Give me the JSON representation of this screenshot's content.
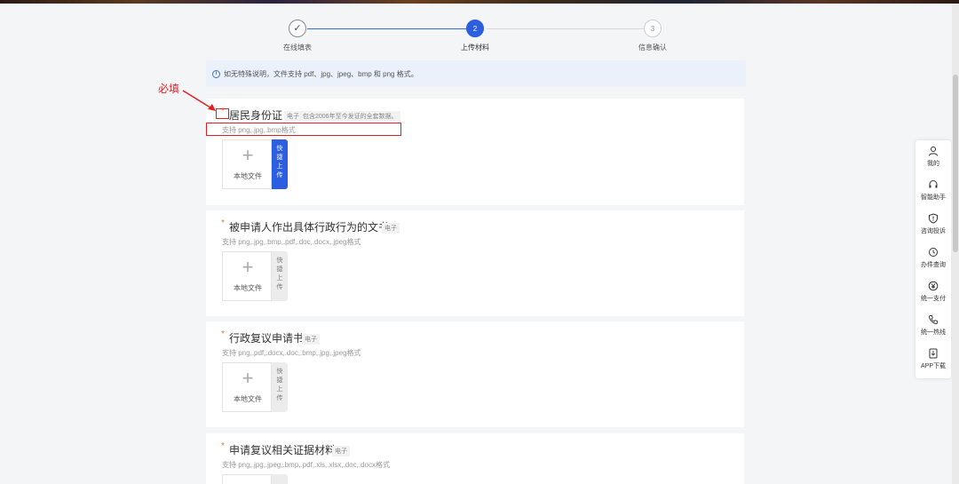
{
  "steps": [
    {
      "num": "✓",
      "label": "在线填表"
    },
    {
      "num": "2",
      "label": "上传材料"
    },
    {
      "num": "3",
      "label": "信息确认"
    }
  ],
  "notice": {
    "icon": "info-icon",
    "text": "如无特殊说明，文件支持 pdf、jpg、jpeg、bmp 和 png 格式。"
  },
  "annotation": {
    "text": "必填"
  },
  "cards": [
    {
      "required": "*",
      "title": "居民身份证",
      "tag": "电子",
      "subtag": "包含2006年至今发证的全套数据。",
      "hint": "支持 png,.jpg,.bmp格式",
      "upload_label": "本地文件",
      "quick_label": "快捷上传"
    },
    {
      "required": "*",
      "title": "被申请人作出具体行政行为的文书",
      "tag": "电子",
      "hint": "支持 png,.jpg,.bmp,.pdf,.doc,.docx,.jpeg格式",
      "upload_label": "本地文件",
      "quick_label": "快捷上传"
    },
    {
      "required": "*",
      "title": "行政复议申请书",
      "tag": "电子",
      "hint": "支持 png,.pdf,.docx,.doc,.bmp,.jpg,.jpeg格式",
      "upload_label": "本地文件",
      "quick_label": "快捷上传"
    },
    {
      "required": "*",
      "title": "申请复议相关证据材料",
      "tag": "电子",
      "hint": "支持 png,.jpg,.jpeg,.bmp,.pdf,.xls,.xlsx,.doc,.docx格式"
    }
  ],
  "sidebar": [
    {
      "icon": "user-icon",
      "label": "我的"
    },
    {
      "icon": "headset-icon",
      "label": "智能助手"
    },
    {
      "icon": "shield-icon",
      "label": "咨询投诉"
    },
    {
      "icon": "clock-icon",
      "label": "办件查询"
    },
    {
      "icon": "yen-icon",
      "label": "统一支付"
    },
    {
      "icon": "phone-icon",
      "label": "统一热线"
    },
    {
      "icon": "download-icon",
      "label": "APP下载"
    }
  ],
  "colors": {
    "primary": "#2b5ee0",
    "annotation": "#e02020",
    "required": "#e07a3a"
  }
}
